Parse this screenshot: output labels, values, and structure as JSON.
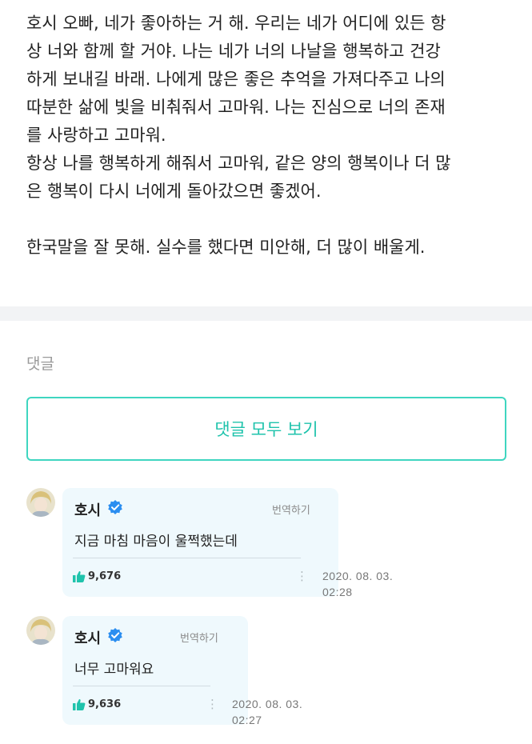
{
  "post": {
    "lines": [
      "호시 오빠, 네가 좋아하는 거 해. 우리는 네가 어디에 있든 항",
      "상 너와 함께 할 거야. 나는 네가 너의 나날을 행복하고 건강",
      "하게 보내길 바래. 나에게 많은 좋은 추억을 가져다주고 나의",
      "따분한 삶에 빛을 비춰줘서 고마워. 나는 진심으로 너의 존재",
      "를 사랑하고 고마워.",
      "항상 나를 행복하게 해줘서 고마워, 같은 양의 행복이나 더 많",
      "은 행복이 다시 너에게 돌아갔으면 좋겠어.",
      "",
      "한국말을 잘 못해. 실수를 했다면 미안해, 더 많이 배울게."
    ]
  },
  "comments_section": {
    "label": "댓글",
    "view_all_label": "댓글 모두 보기",
    "accent_color": "#3fd6c0"
  },
  "comments": [
    {
      "author": "호시",
      "verified_icon": "verified-check-icon",
      "translate_label": "번역하기",
      "text": "지금 마침 마음이 울쩍했는데",
      "likes": "9,676",
      "date": "2020. 08. 03.",
      "time": "02:28"
    },
    {
      "author": "호시",
      "verified_icon": "verified-check-icon",
      "translate_label": "번역하기",
      "text": "너무 고마워요",
      "likes": "9,636",
      "date": "2020. 08. 03.",
      "time": "02:27"
    }
  ]
}
